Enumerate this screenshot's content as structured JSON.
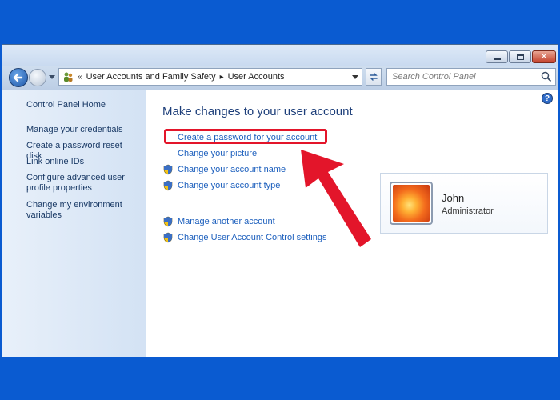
{
  "window": {
    "caption_buttons": {
      "minimize": "minimize",
      "maximize": "maximize",
      "close": "✕"
    }
  },
  "address_bar": {
    "prefix": "«",
    "crumbs": [
      "User Accounts and Family Safety",
      "User Accounts"
    ],
    "separator": "▸"
  },
  "search": {
    "placeholder": "Search Control Panel"
  },
  "sidebar": {
    "home": "Control Panel Home",
    "items": [
      "Manage your credentials",
      "Create a password reset disk",
      "Link online IDs",
      "Configure advanced user profile properties",
      "Change my environment variables"
    ]
  },
  "main": {
    "heading": "Make changes to your user account",
    "tasks": [
      {
        "label": "Create a password for your account",
        "shield": false
      },
      {
        "label": "Change your picture",
        "shield": false
      },
      {
        "label": "Change your account name",
        "shield": true
      },
      {
        "label": "Change your account type",
        "shield": true
      }
    ],
    "more_tasks": [
      {
        "label": "Manage another account",
        "shield": true
      },
      {
        "label": "Change User Account Control settings",
        "shield": true
      }
    ]
  },
  "user": {
    "name": "John",
    "role": "Administrator"
  },
  "help": {
    "label": "?"
  },
  "colors": {
    "highlight": "#e3152a",
    "link": "#1c5fbd",
    "background": "#0a5bd1"
  }
}
